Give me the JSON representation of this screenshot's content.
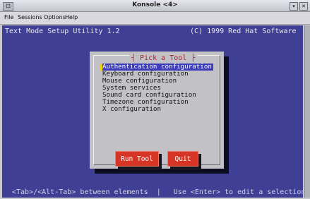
{
  "window": {
    "title": "Konsole <4>",
    "sys_button": "⊡",
    "minimize_glyph": "▾",
    "close_glyph": "✕"
  },
  "menubar": {
    "items": [
      "File",
      "Sessions",
      "Options",
      "Help"
    ]
  },
  "terminal": {
    "header_left": "Text Mode Setup Utility 1.2",
    "header_right": "(C) 1999 Red Hat Software",
    "footer": "<Tab>/<Alt-Tab> between elements  |   Use <Enter> to edit a selection"
  },
  "dialog": {
    "title": "Pick a Tool",
    "options": [
      "Authentication configuration",
      "Keyboard configuration",
      "Mouse configuration",
      "System services",
      "Sound card configuration",
      "Timezone configuration",
      "X configuration"
    ],
    "selected_index": 0,
    "buttons": {
      "run": "Run Tool",
      "quit": "Quit"
    }
  },
  "colors": {
    "terminal_bg": "#3f3f95",
    "dialog_bg": "#c2c2c6",
    "selection": "#3d3dbc",
    "button": "#d63424",
    "dialog_title": "#b8202a"
  }
}
